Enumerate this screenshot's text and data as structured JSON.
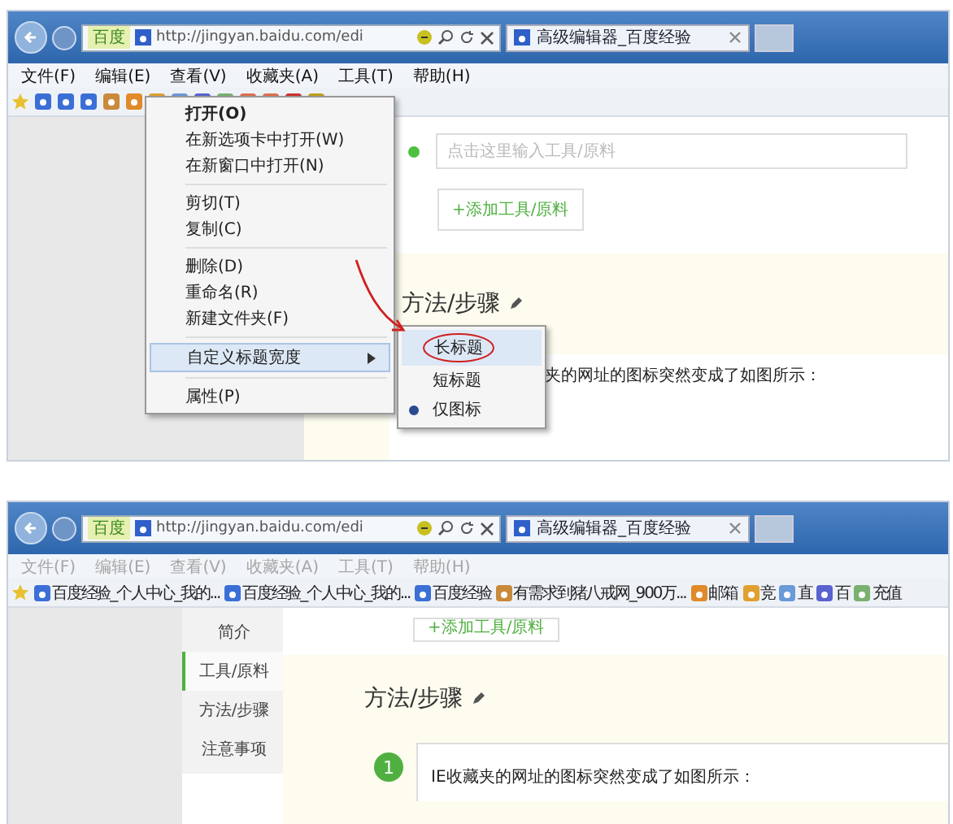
{
  "screens": [
    {
      "browser": {
        "search_provider": "百度",
        "url": "http://jingyan.baidu.com/edi",
        "tab_title": "高级编辑器_百度经验",
        "menubar": {
          "disabled": false,
          "items": [
            "文件(F)",
            "编辑(E)",
            "查看(V)",
            "收藏夹(A)",
            "工具(T)",
            "帮助(H)"
          ]
        },
        "favorites_bar": {
          "icon_only": true
        }
      },
      "page": {
        "kind": "editor",
        "field_placeholder": "点击这里输入工具/原料",
        "add_button": "+添加工具/原料",
        "heading": "方法/步骤",
        "text": "夹的网址的图标突然变成了如图所示：",
        "context_menu": [
          {
            "kind": "item",
            "label": "打开(O)",
            "default": true
          },
          {
            "kind": "item",
            "label": "在新选项卡中打开(W)",
            "default": false
          },
          {
            "kind": "item",
            "label": "在新窗口中打开(N)",
            "default": false
          },
          {
            "kind": "separator"
          },
          {
            "kind": "item",
            "label": "剪切(T)",
            "default": false
          },
          {
            "kind": "item",
            "label": "复制(C)",
            "default": false
          },
          {
            "kind": "separator"
          },
          {
            "kind": "item",
            "label": "删除(D)",
            "default": false
          },
          {
            "kind": "item",
            "label": "重命名(R)",
            "default": false
          },
          {
            "kind": "item",
            "label": "新建文件夹(F)",
            "default": false
          },
          {
            "kind": "separator"
          },
          {
            "kind": "submenu",
            "label": "自定义标题宽度",
            "highlighted": true
          },
          {
            "kind": "separator"
          },
          {
            "kind": "item",
            "label": "属性(P)",
            "default": false
          }
        ],
        "submenu": [
          {
            "label": "长标题",
            "selected": false,
            "circled": true
          },
          {
            "label": "短标题",
            "selected": false,
            "circled": false
          },
          {
            "label": "仅图标",
            "selected": true,
            "circled": false
          }
        ]
      }
    },
    {
      "browser": {
        "search_provider": "百度",
        "url": "http://jingyan.baidu.com/edi",
        "tab_title": "高级编辑器_百度经验",
        "menubar": {
          "disabled": true,
          "items": [
            "文件(F)",
            "编辑(E)",
            "查看(V)",
            "收藏夹(A)",
            "工具(T)",
            "帮助(H)"
          ]
        },
        "favorites_bar": {
          "icon_only": false,
          "items": [
            "百度经验_个人中心_我的...",
            "百度经验_个人中心_我的...",
            "百度经验",
            "有需求到猪八戒网_900万...",
            "邮箱",
            "竞",
            "直",
            "百",
            "充值"
          ]
        }
      },
      "page": {
        "kind": "article",
        "add_button": "+添加工具/原料",
        "nav": [
          {
            "label": "简介",
            "selected": false
          },
          {
            "label": "工具/原料",
            "selected": true
          },
          {
            "label": "方法/步骤",
            "selected": false
          },
          {
            "label": "注意事项",
            "selected": false
          }
        ],
        "heading": "方法/步骤",
        "step_number": "1",
        "text": "IE收藏夹的网址的图标突然变成了如图所示："
      }
    }
  ]
}
